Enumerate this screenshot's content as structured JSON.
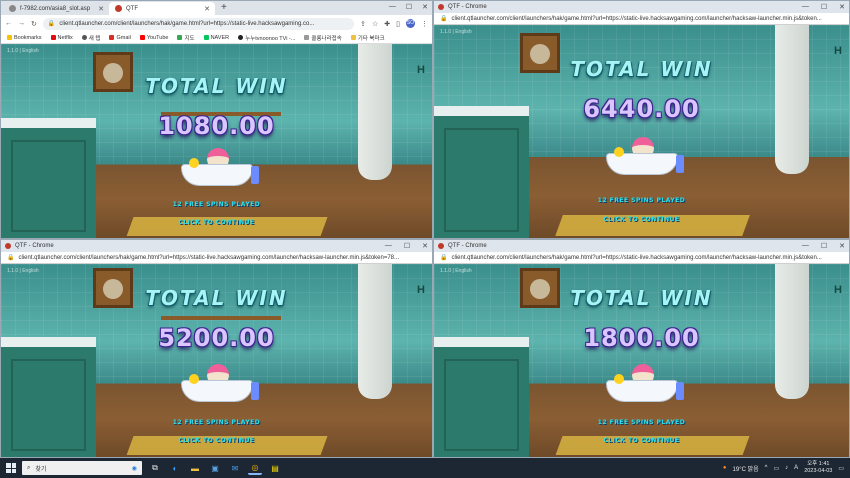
{
  "browser_main": {
    "tabs": [
      {
        "label": "f-7982.com/asia8_slot.asp",
        "active": false
      },
      {
        "label": "QTF",
        "active": true
      }
    ],
    "url": "client.qtlauncher.com/client/launchers/hak/game.html?url=https://static-live.hacksawgaming.co...",
    "bookmarks": [
      "Bookmarks",
      "Netflix",
      "새 탭",
      "Gmail",
      "YouTube",
      "지도",
      "NAVER",
      "누누tvnoonoo TVi -...",
      "쿨롱나라접속",
      "기타 북마크"
    ],
    "avatar": "SO"
  },
  "popups": [
    {
      "title": "QTF - Chrome",
      "url": "client.qtlauncher.com/client/launchers/hak/game.html?url=https://static-live.hacksawgaming.com/launcher/hacksaw-launcher.min.js&token..."
    },
    {
      "title": "QTF - Chrome",
      "url": "client.qtlauncher.com/client/launchers/hak/game.html?url=https://static-live.hacksawgaming.com/launcher/hacksaw-launcher.min.js&token=78..."
    },
    {
      "title": "QTF - Chrome",
      "url": "client.qtlauncher.com/client/launchers/hak/game.html?url=https://static-live.hacksawgaming.com/launcher/hacksaw-launcher.min.js&token..."
    }
  ],
  "games": [
    {
      "label": "TOTAL WIN",
      "amount": "1080.00",
      "spins": "12 FREE SPINS PLAYED",
      "cta": "CLICK TO CONTINUE"
    },
    {
      "label": "TOTAL WIN",
      "amount": "6440.00",
      "spins": "12 FREE SPINS PLAYED",
      "cta": "CLICK TO CONTINUE"
    },
    {
      "label": "TOTAL WIN",
      "amount": "5200.00",
      "spins": "12 FREE SPINS PLAYED",
      "cta": "CLICK TO CONTINUE"
    },
    {
      "label": "TOTAL WIN",
      "amount": "1800.00",
      "spins": "12 FREE SPINS PLAYED",
      "cta": "CLICK TO CONTINUE"
    }
  ],
  "game_tag": "1.1.0 | English",
  "taskbar": {
    "search_placeholder": "찾기",
    "weather": "19°C 맑음",
    "time": "오후 1:41",
    "date": "2023-04-03"
  }
}
